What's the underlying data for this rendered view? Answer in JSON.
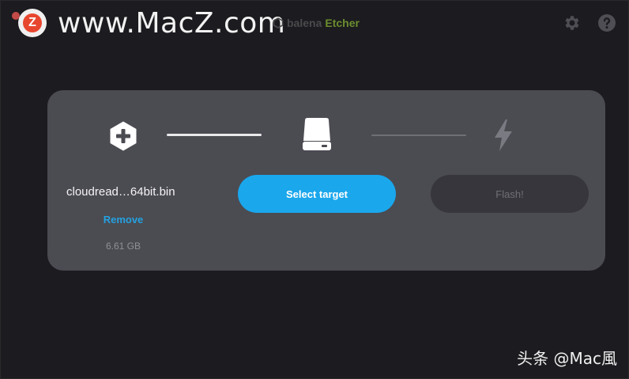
{
  "watermark": {
    "logo_letter": "Z",
    "text": "www.MacZ.com"
  },
  "brand": {
    "prefix": "balena",
    "suffix": "Etcher"
  },
  "header": {
    "settings_icon": "gear-icon",
    "help_icon": "question-circle-icon"
  },
  "steps": {
    "image": {
      "icon": "plus-hexagon-icon",
      "filename": "cloudread…64bit.bin",
      "remove_label": "Remove",
      "size": "6.61 GB"
    },
    "target": {
      "icon": "drive-icon",
      "button_label": "Select target"
    },
    "flash": {
      "icon": "lightning-icon",
      "button_label": "Flash!"
    }
  },
  "footer": {
    "text": "头条 @Mac風"
  },
  "colors": {
    "accent": "#1aa7ec",
    "link": "#23a2e0",
    "card": "#4b4b52",
    "background": "#1c1b1f",
    "brand_green": "#6b8d2f"
  }
}
